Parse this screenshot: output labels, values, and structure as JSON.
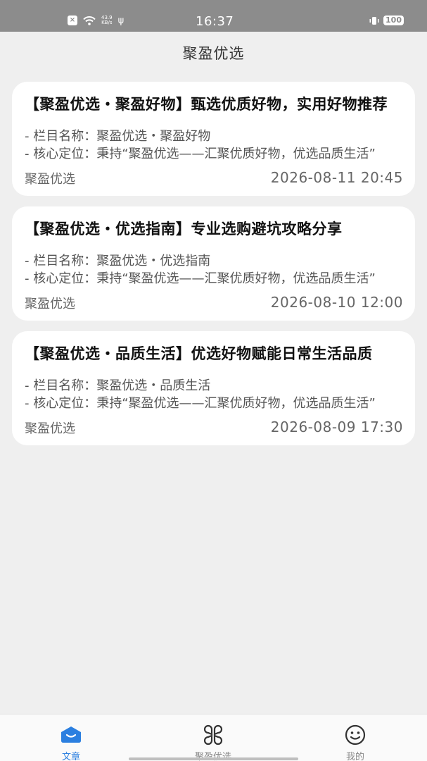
{
  "status_bar": {
    "speed_value": "43.9",
    "speed_unit": "KB/s",
    "time": "16:37",
    "battery": "100"
  },
  "header": {
    "title": "聚盈优选"
  },
  "articles": [
    {
      "title": "【聚盈优选・聚盈好物】甄选优质好物，实用好物推荐",
      "line1": "- 栏目名称：聚盈优选・聚盈好物",
      "line2": "- 核心定位：秉持“聚盈优选——汇聚优质好物，优选品质生活”",
      "source": "聚盈优选",
      "date": "2026-08-11 20:45"
    },
    {
      "title": "【聚盈优选・优选指南】专业选购避坑攻略分享",
      "line1": "- 栏目名称：聚盈优选・优选指南",
      "line2": "- 核心定位：秉持“聚盈优选——汇聚优质好物，优选品质生活”",
      "source": "聚盈优选",
      "date": "2026-08-10 12:00"
    },
    {
      "title": "【聚盈优选・品质生活】优选好物赋能日常生活品质",
      "line1": "- 栏目名称：聚盈优选・品质生活",
      "line2": "- 核心定位：秉持“聚盈优选——汇聚优质好物，优选品质生活”",
      "source": "聚盈优选",
      "date": "2026-08-09 17:30"
    }
  ],
  "tabs": [
    {
      "label": "文章",
      "icon": "article-icon",
      "active": true
    },
    {
      "label": "聚盈优选",
      "icon": "grid-icon",
      "active": false
    },
    {
      "label": "我的",
      "icon": "smiley-icon",
      "active": false
    }
  ],
  "colors": {
    "accent": "#2b7fe0",
    "background": "#efefef",
    "status_bar": "#8c8c8c"
  }
}
